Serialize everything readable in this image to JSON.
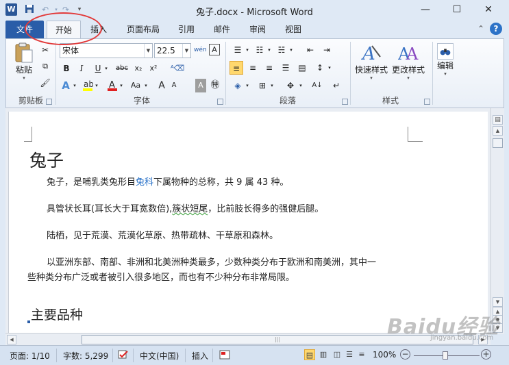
{
  "window": {
    "title": "兔子.docx - Microsoft Word",
    "min_label": "—",
    "max_label": "☐",
    "close_label": "✕"
  },
  "quick_access": {
    "logo_letter": "W",
    "save_icon": "save-icon",
    "undo_icon": "undo-icon",
    "redo_icon": "redo-icon"
  },
  "tabs": {
    "file": "文件",
    "items": [
      "开始",
      "插入",
      "页面布局",
      "引用",
      "邮件",
      "审阅",
      "视图"
    ],
    "active_index": 0
  },
  "ribbon": {
    "clipboard": {
      "paste_label": "粘贴",
      "group_label": "剪贴板"
    },
    "font": {
      "font_name": "宋体",
      "font_size": "22.5",
      "group_label": "字体",
      "bold": "B",
      "italic": "I",
      "underline": "U",
      "strike": "abc",
      "subscript": "x₂",
      "superscript": "x²",
      "grow": "A",
      "shrink": "A",
      "case": "Aa",
      "wen": "wén"
    },
    "paragraph": {
      "group_label": "段落"
    },
    "styles": {
      "quick_styles_label": "快速样式",
      "change_styles_label": "更改样式",
      "group_label": "样式"
    },
    "editing": {
      "label": "编辑"
    }
  },
  "document": {
    "title": "兔子",
    "p1_before": "兔子，是哺乳类兔形目",
    "p1_link": "兔科",
    "p1_after": "下属物种的总称，共 9 属 43 种。",
    "p2_before": "具管状长耳(耳长大于耳宽数倍),",
    "p2_squiggle": "簇状短尾",
    "p2_after": "，比前肢长得多的强健后腿。",
    "p3": "陆栖，见于荒漠、荒漠化草原、热带疏林、干草原和森林。",
    "p4_line1": "以亚洲东部、南部、非洲和北美洲种类最多，少数种类分布于欧洲和南美洲，其中一",
    "p4_line2": "些种类分布广泛或者被引入很多地区，而也有不少种分布非常局限。",
    "heading": "主要品种"
  },
  "status": {
    "page": "页面: 1/10",
    "words": "字数: 5,299",
    "language": "中文(中国)",
    "mode": "插入",
    "zoom": "100%",
    "zoom_minus": "−",
    "zoom_plus": "+"
  },
  "watermark": {
    "text": "Baidu经验",
    "sub": "jingyan.baidu.com"
  }
}
